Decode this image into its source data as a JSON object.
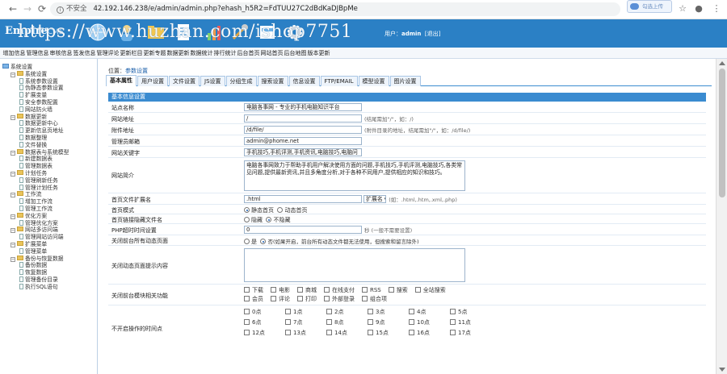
{
  "browser": {
    "back": "←",
    "forward": "→",
    "reload": "⟳",
    "insecure_label": "不安全",
    "url": "42.192.146.238/e/admin/admin.php?ehash_h5R2=FdTUU27C2dBdKaDJBpMe",
    "extension_label": "勾选上传"
  },
  "header": {
    "logo": "Empire",
    "logo_cms": "CMS",
    "watermark": "https://www.huzhan.com/ishop7751",
    "user_label": "用户：",
    "user_name": "admin",
    "logout": "[退出]"
  },
  "menu": [
    "增加信息",
    "管理信息",
    "审核信息",
    "签发信息",
    "管理评论",
    "更新栏目",
    "更新专题",
    "数据更新",
    "数据统计",
    "排行统计",
    "后台首页",
    "网站首页",
    "后台地图",
    "版本更新"
  ],
  "sidebar": [
    {
      "level": 0,
      "type": "root",
      "label": "系统设置"
    },
    {
      "level": 1,
      "type": "folder",
      "label": "系统设置"
    },
    {
      "level": 2,
      "type": "doc",
      "label": "系统参数设置"
    },
    {
      "level": 2,
      "type": "doc",
      "label": "伪静态参数设置"
    },
    {
      "level": 2,
      "type": "doc",
      "label": "扩展变量"
    },
    {
      "level": 2,
      "type": "doc",
      "label": "安全参数配置"
    },
    {
      "level": 2,
      "type": "doc",
      "label": "网站防火墙"
    },
    {
      "level": 1,
      "type": "folder",
      "label": "数据更新"
    },
    {
      "level": 2,
      "type": "doc",
      "label": "数据更新中心"
    },
    {
      "level": 2,
      "type": "doc",
      "label": "更新信息页地址"
    },
    {
      "level": 2,
      "type": "doc",
      "label": "数据整理"
    },
    {
      "level": 2,
      "type": "doc",
      "label": "文件替换"
    },
    {
      "level": 1,
      "type": "folder",
      "label": "数据表与系统模型"
    },
    {
      "level": 2,
      "type": "doc",
      "label": "新建数据表"
    },
    {
      "level": 2,
      "type": "doc",
      "label": "管理数据表"
    },
    {
      "level": 1,
      "type": "folder",
      "label": "计划任务"
    },
    {
      "level": 2,
      "type": "doc",
      "label": "管理刷新任务"
    },
    {
      "level": 2,
      "type": "doc",
      "label": "管理计划任务"
    },
    {
      "level": 1,
      "type": "folder",
      "label": "工作流"
    },
    {
      "level": 2,
      "type": "doc",
      "label": "增加工作流"
    },
    {
      "level": 2,
      "type": "doc",
      "label": "管理工作流"
    },
    {
      "level": 1,
      "type": "folder",
      "label": "优化方案"
    },
    {
      "level": 2,
      "type": "doc",
      "label": "管理优化方案"
    },
    {
      "level": 1,
      "type": "folder",
      "label": "网站多访问端"
    },
    {
      "level": 2,
      "type": "doc",
      "label": "管理网站访问端"
    },
    {
      "level": 1,
      "type": "folder",
      "label": "扩展菜单"
    },
    {
      "level": 2,
      "type": "doc",
      "label": "管理菜单"
    },
    {
      "level": 1,
      "type": "folder",
      "label": "备份与恢复数据"
    },
    {
      "level": 2,
      "type": "doc",
      "label": "备份数据"
    },
    {
      "level": 2,
      "type": "doc",
      "label": "恢复数据"
    },
    {
      "level": 2,
      "type": "doc",
      "label": "管理备份目录"
    },
    {
      "level": 2,
      "type": "doc",
      "label": "执行SQL语句"
    }
  ],
  "location": {
    "prefix": "位置：",
    "link": "参数设置"
  },
  "tabs": [
    {
      "label": "基本属性",
      "active": true
    },
    {
      "label": "用户设置",
      "active": false
    },
    {
      "label": "文件设置",
      "active": false
    },
    {
      "label": "JS设置",
      "active": false
    },
    {
      "label": "分组生成",
      "active": false
    },
    {
      "label": "搜索设置",
      "active": false
    },
    {
      "label": "信息设置",
      "active": false
    },
    {
      "label": "FTP/EMAIL",
      "active": false
    },
    {
      "label": "模型设置",
      "active": false
    },
    {
      "label": "图片设置",
      "active": false
    }
  ],
  "form": {
    "section_title": "基本信息设置",
    "site_name_label": "站点名称",
    "site_name_value": "电脑各事网 - 专业的手机电脑知识平台",
    "site_url_label": "网站地址",
    "site_url_value": "/",
    "site_url_hint": "(结尾需加\"/\"，如：/)",
    "attach_dir_label": "附件地址",
    "attach_dir_value": "/d/file/",
    "attach_dir_hint": "(附件目录的地址，结尾需加\"/\"，如：/d/file/)",
    "admin_email_label": "管理员邮箱",
    "admin_email_value": "admin@phome.net",
    "keywords_label": "网站关键字",
    "keywords_value": "手机技巧,手机评测,手机资讯,电脑技巧,电脑问",
    "intro_label": "网站简介",
    "intro_value": "电脑各事网致力于帮助手机用户解决使用方面的问题,手机技巧,手机评测,电脑技巧,各类常见问题,提供最新资讯,并且多角度分析,对于各种不同用户,提供相应的知识和技巧。",
    "ext_label": "首页文件扩展名",
    "ext_value": ".html",
    "ext_select": "扩展名 ▾",
    "ext_hint": "(如：.html,.htm,.xml,.php)",
    "mode_label": "首页模式",
    "mode_static": "静态首页",
    "mode_dynamic": "动态首页",
    "hide_index_label": "首页链接隐藏文件名",
    "hide_index_yes": "隐藏",
    "hide_index_no": "不隐藏",
    "timeout_label": "PHP超时时间设置",
    "timeout_value": "0",
    "timeout_hint": "秒 (一般不需要设置)",
    "close_front_label": "关闭前台所有动态页面",
    "close_front_yes": "是",
    "close_front_no": "否(如果开启，前台所有动态文件都无法使用，但搜索和留言除外)",
    "close_tip_label": "关闭动态页面提示内容",
    "close_modules_label": "关闭前台模块相关功能",
    "modules_row1": [
      "下载",
      "电影",
      "商城",
      "在线支付",
      "RSS",
      "搜索",
      "全站搜索"
    ],
    "modules_row2": [
      "会员",
      "评论",
      "打印",
      "外部登录",
      "组合项"
    ],
    "no_ops_label": "不开启操作的时间点",
    "hours": [
      "0点",
      "1点",
      "2点",
      "3点",
      "4点",
      "5点",
      "6点",
      "7点",
      "8点",
      "9点",
      "10点",
      "11点",
      "12点",
      "13点",
      "14点",
      "15点",
      "16点",
      "17点"
    ]
  }
}
